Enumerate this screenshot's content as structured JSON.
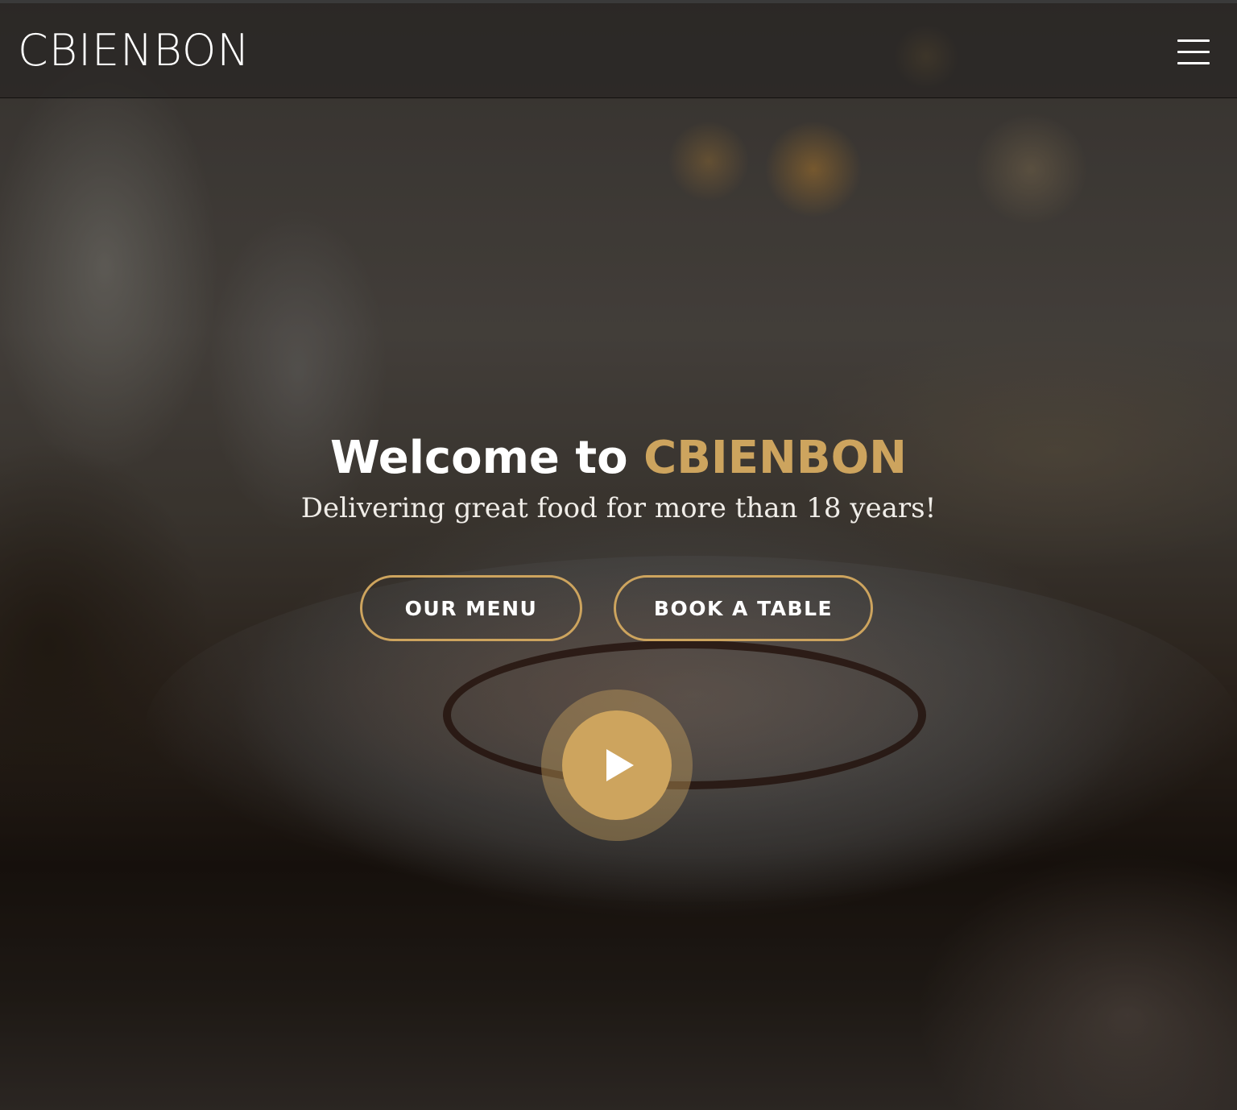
{
  "header": {
    "logo": "CBIENBON",
    "menu_icon": "hamburger-menu-icon"
  },
  "hero": {
    "title_prefix": "Welcome to ",
    "title_brand": "CBIENBON",
    "subtitle": "Delivering great food for more than 18 years!",
    "buttons": {
      "menu_label": "OUR MENU",
      "book_label": "BOOK A TABLE"
    },
    "play_icon": "play-icon"
  },
  "colors": {
    "accent": "#cda45e",
    "text": "#ffffff",
    "header_bg": "#282624"
  }
}
